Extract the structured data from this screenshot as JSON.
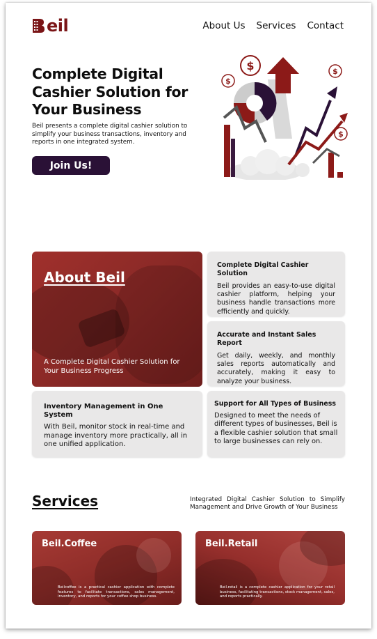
{
  "brand": {
    "logo_text": "eil",
    "logo_initial": "B",
    "color": "#7a1416"
  },
  "nav": {
    "items": [
      "About Us",
      "Services",
      "Contact"
    ]
  },
  "hero": {
    "title": "Complete Digital Cashier Solution for Your Business",
    "description": "Beil presents a complete digital cashier solution to simplify your business transactions, inventory and reports in one integrated system.",
    "cta": "Join Us!",
    "cta_color": "#2a1136"
  },
  "about": {
    "title": "About Beil",
    "subtitle": "A Complete Digital Cashier Solution for Your Business Progress",
    "cards": [
      {
        "title": "Complete Digital Cashier Solution",
        "text": "Beil provides an easy-to-use digital cashier platform, helping your business handle transactions more efficiently and quickly."
      },
      {
        "title": "Accurate and Instant Sales Report",
        "text": "Get daily, weekly, and monthly sales reports automatically and accurately, making it easy to analyze your business."
      },
      {
        "title": "Inventory Management in One System",
        "text": "With Beil, monitor stock in real-time and manage inventory more practically, all in one unified application."
      },
      {
        "title": "Support for All Types of Business",
        "text": "Designed to meet the needs of different types of businesses, Beil is a flexible cashier solution that small to large businesses can rely on."
      }
    ]
  },
  "services": {
    "title": "Services",
    "description": "Integrated Digital Cashier Solution to Simplify Management and Drive Growth of Your Business",
    "items": [
      {
        "name": "Beil.Coffee",
        "text": "Beilcoffee is a practical cashier application with complete features to facilitate transactions, sales management, inventory, and reports for your coffee shop business."
      },
      {
        "name": "Beil.Retail",
        "text": "Beil.retail is a complete cashier application for your retail business, facilitating transactions, stock management, sales, and reports practically."
      }
    ]
  },
  "colors": {
    "accent": "#8c2a27",
    "dark": "#2a1136",
    "card_bg": "#e9e8e8"
  }
}
